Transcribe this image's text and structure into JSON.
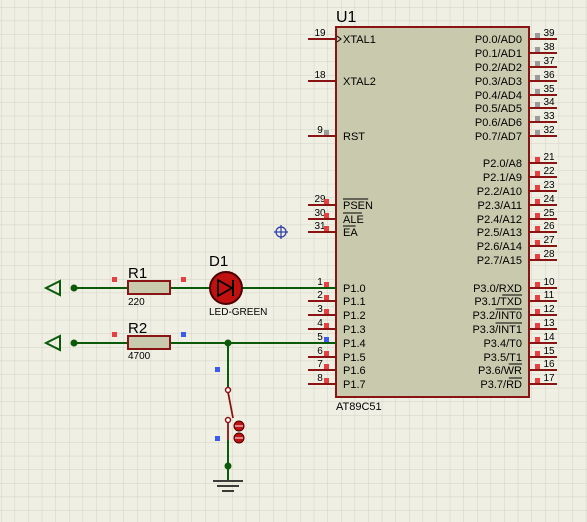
{
  "colors": {
    "background": "#efefe3",
    "grid": "#d2d2c6",
    "chip_fill": "#c9c9ae",
    "chip_border": "#8a1414",
    "wire": "#0a5a0a",
    "pin_line": "#8a1414",
    "label": "#000000",
    "pin_marker_red": "#e84040",
    "pin_marker_gray": "#9a9a9a",
    "pin_marker_blue": "#3a5af0",
    "led_body": "#c01010",
    "led_outline": "#4a0000"
  },
  "chip": {
    "designator": "U1",
    "part": "AT89C51",
    "left_pins": [
      {
        "num": "19",
        "name": "XTAL1",
        "marker": "none",
        "clock": true
      },
      {
        "num": "18",
        "name": "XTAL2",
        "marker": "none"
      },
      {
        "num": "9",
        "name": "RST",
        "marker": "gray"
      },
      {
        "num": "29",
        "name": "PSEN",
        "marker": "red",
        "overbar": true
      },
      {
        "num": "30",
        "name": "ALE",
        "marker": "red",
        "overbar": true
      },
      {
        "num": "31",
        "name": "EA",
        "marker": "red",
        "overbar": true
      },
      {
        "num": "1",
        "name": "P1.0",
        "marker": "red"
      },
      {
        "num": "2",
        "name": "P1.1",
        "marker": "red"
      },
      {
        "num": "3",
        "name": "P1.2",
        "marker": "red"
      },
      {
        "num": "4",
        "name": "P1.3",
        "marker": "red"
      },
      {
        "num": "5",
        "name": "P1.4",
        "marker": "blue"
      },
      {
        "num": "6",
        "name": "P1.5",
        "marker": "red"
      },
      {
        "num": "7",
        "name": "P1.6",
        "marker": "red"
      },
      {
        "num": "8",
        "name": "P1.7",
        "marker": "red"
      }
    ],
    "right_pins": [
      {
        "num": "39",
        "name": "P0.0/AD0",
        "marker": "gray"
      },
      {
        "num": "38",
        "name": "P0.1/AD1",
        "marker": "gray"
      },
      {
        "num": "37",
        "name": "P0.2/AD2",
        "marker": "gray"
      },
      {
        "num": "36",
        "name": "P0.3/AD3",
        "marker": "gray"
      },
      {
        "num": "35",
        "name": "P0.4/AD4",
        "marker": "gray"
      },
      {
        "num": "34",
        "name": "P0.5/AD5",
        "marker": "gray"
      },
      {
        "num": "33",
        "name": "P0.6/AD6",
        "marker": "gray"
      },
      {
        "num": "32",
        "name": "P0.7/AD7",
        "marker": "gray"
      },
      {
        "num": "21",
        "name": "P2.0/A8",
        "marker": "red"
      },
      {
        "num": "22",
        "name": "P2.1/A9",
        "marker": "red"
      },
      {
        "num": "23",
        "name": "P2.2/A10",
        "marker": "red"
      },
      {
        "num": "24",
        "name": "P2.3/A11",
        "marker": "red"
      },
      {
        "num": "25",
        "name": "P2.4/A12",
        "marker": "red"
      },
      {
        "num": "26",
        "name": "P2.5/A13",
        "marker": "red"
      },
      {
        "num": "27",
        "name": "P2.6/A14",
        "marker": "red"
      },
      {
        "num": "28",
        "name": "P2.7/A15",
        "marker": "red"
      },
      {
        "num": "10",
        "name": "P3.0/RXD",
        "marker": "red"
      },
      {
        "num": "11",
        "name": "P3.1/TXD",
        "marker": "red",
        "overbar_part": "TXD"
      },
      {
        "num": "12",
        "name": "P3.2/INT0",
        "marker": "red",
        "overbar_part": "INT0"
      },
      {
        "num": "13",
        "name": "P3.3/INT1",
        "marker": "red",
        "overbar_part": "INT1"
      },
      {
        "num": "14",
        "name": "P3.4/T0",
        "marker": "red"
      },
      {
        "num": "15",
        "name": "P3.5/T1",
        "marker": "red"
      },
      {
        "num": "16",
        "name": "P3.6/WR",
        "marker": "red",
        "overbar_part": "WR"
      },
      {
        "num": "17",
        "name": "P3.7/RD",
        "marker": "red",
        "overbar_part": "RD"
      }
    ]
  },
  "resistors": [
    {
      "designator": "R1",
      "value": "220"
    },
    {
      "designator": "R2",
      "value": "4700"
    }
  ],
  "led": {
    "designator": "D1",
    "value": "LED-GREEN"
  }
}
